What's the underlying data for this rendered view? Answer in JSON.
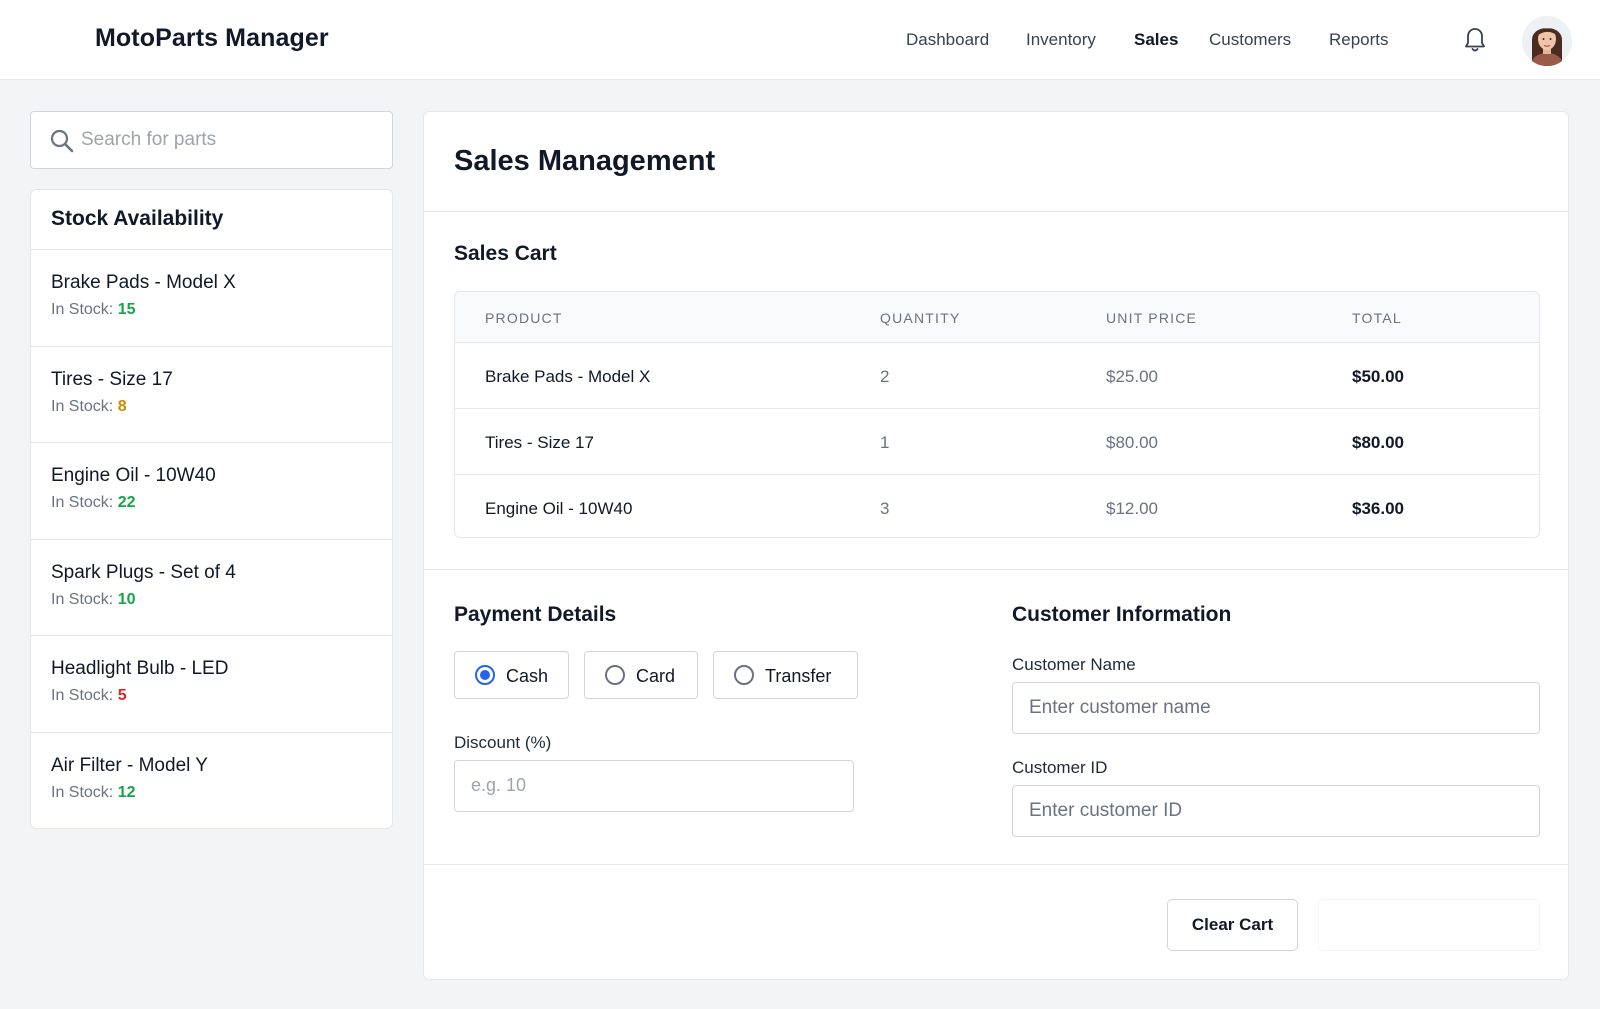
{
  "app": {
    "title": "MotoParts Manager"
  },
  "nav": {
    "items": [
      {
        "label": "Dashboard",
        "active": false
      },
      {
        "label": "Inventory",
        "active": false
      },
      {
        "label": "Sales",
        "active": true
      },
      {
        "label": "Customers",
        "active": false
      },
      {
        "label": "Reports",
        "active": false
      }
    ],
    "notification_icon": "bell-icon",
    "avatar_icon": "user-avatar"
  },
  "search": {
    "placeholder": "Search for parts",
    "value": "",
    "icon": "search-icon"
  },
  "stock": {
    "title": "Stock Availability",
    "in_stock_label": "In Stock:",
    "items": [
      {
        "name": "Brake Pads - Model X",
        "count": "15",
        "color": "#16a34a"
      },
      {
        "name": "Tires - Size 17",
        "count": "8",
        "color": "#ca8a04"
      },
      {
        "name": "Engine Oil - 10W40",
        "count": "22",
        "color": "#16a34a"
      },
      {
        "name": "Spark Plugs - Set of 4",
        "count": "10",
        "color": "#16a34a"
      },
      {
        "name": "Headlight Bulb - LED",
        "count": "5",
        "color": "#dc2626"
      },
      {
        "name": "Air Filter - Model Y",
        "count": "12",
        "color": "#16a34a"
      }
    ]
  },
  "main": {
    "title": "Sales Management",
    "cart": {
      "title": "Sales Cart",
      "columns": [
        "PRODUCT",
        "QUANTITY",
        "UNIT PRICE",
        "TOTAL"
      ],
      "rows": [
        {
          "product": "Brake Pads - Model X",
          "quantity": "2",
          "unit_price": "$25.00",
          "total": "$50.00"
        },
        {
          "product": "Tires - Size 17",
          "quantity": "1",
          "unit_price": "$80.00",
          "total": "$80.00"
        },
        {
          "product": "Engine Oil - 10W40",
          "quantity": "3",
          "unit_price": "$12.00",
          "total": "$36.00"
        }
      ]
    },
    "payment": {
      "title": "Payment Details",
      "methods": [
        {
          "label": "Cash",
          "selected": true
        },
        {
          "label": "Card",
          "selected": false
        },
        {
          "label": "Transfer",
          "selected": false
        }
      ],
      "discount_label": "Discount (%)",
      "discount_placeholder": "e.g. 10",
      "discount_value": ""
    },
    "customer": {
      "title": "Customer Information",
      "name_label": "Customer Name",
      "name_placeholder": "Enter customer name",
      "name_value": "",
      "id_label": "Customer ID",
      "id_placeholder": "Enter customer ID",
      "id_value": ""
    },
    "actions": {
      "clear_label": "Clear Cart"
    }
  },
  "colors": {
    "accent": "#2563eb",
    "stock_ok": "#16a34a",
    "stock_low": "#ca8a04",
    "stock_critical": "#dc2626"
  }
}
